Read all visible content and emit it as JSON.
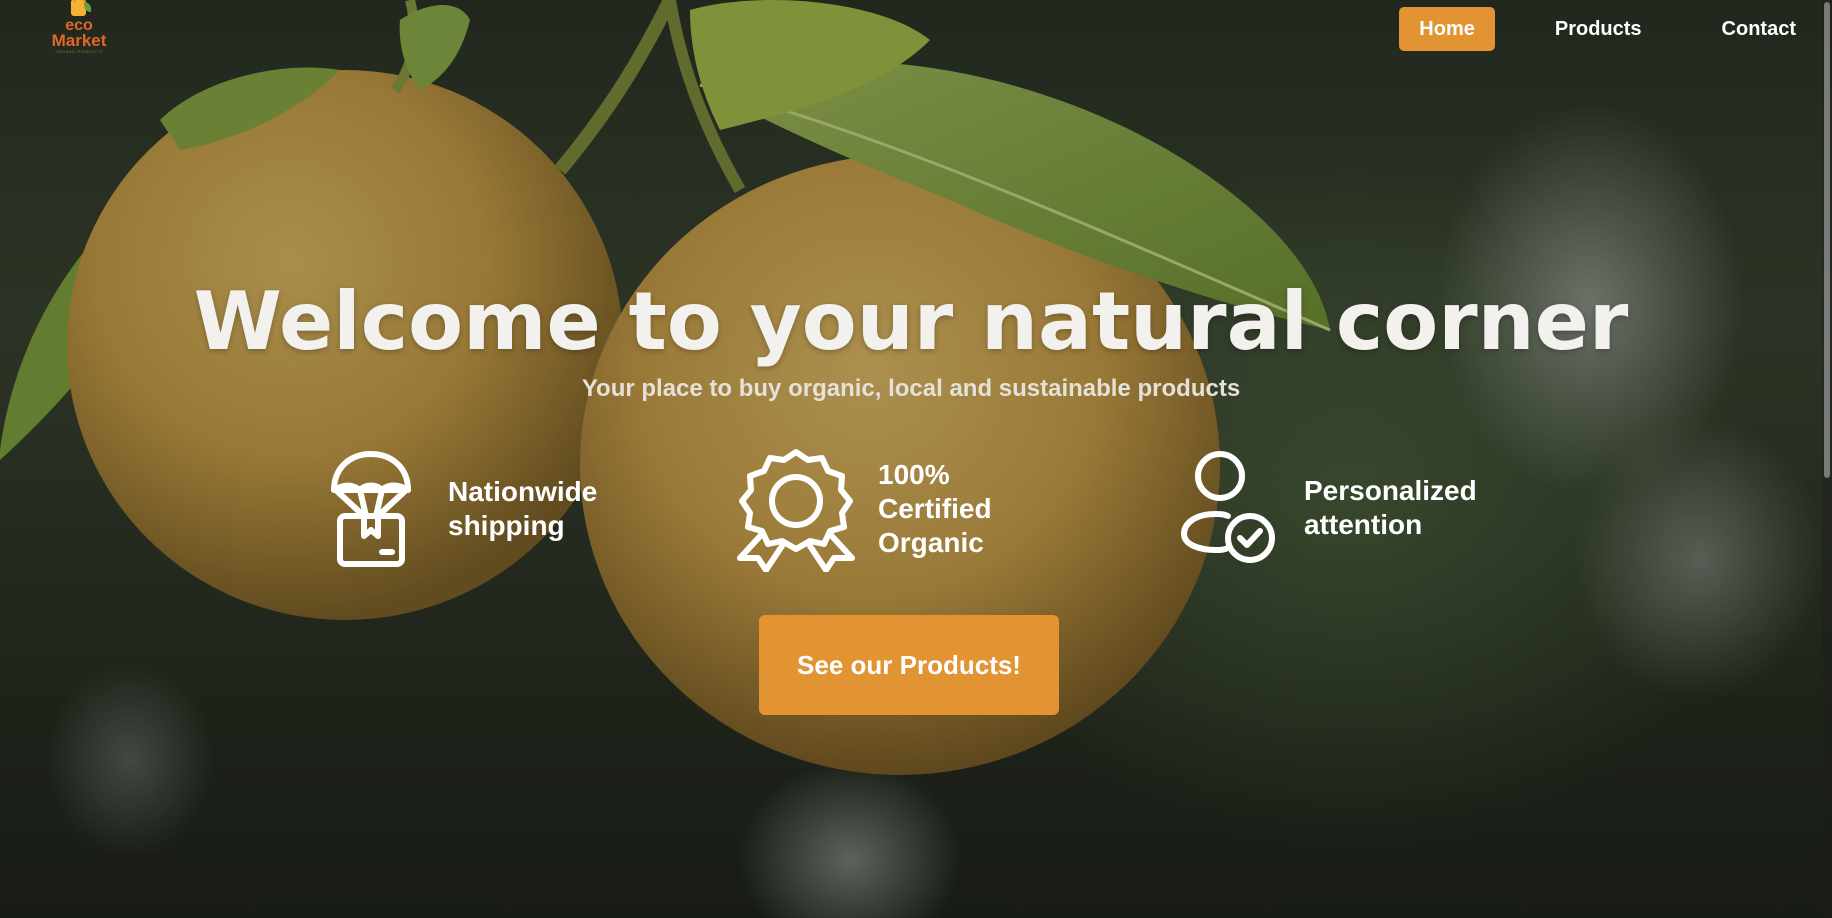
{
  "brand": {
    "logo_eco": "eco",
    "logo_market": "Market",
    "logo_tagline": "ORGANIC PRODUCTS"
  },
  "nav": {
    "items": [
      {
        "label": "Home",
        "active": true
      },
      {
        "label": "Products",
        "active": false
      },
      {
        "label": "Contact",
        "active": false
      }
    ]
  },
  "hero": {
    "title": "Welcome to your natural corner",
    "subtitle": "Your place to buy organic, local and sustainable products"
  },
  "features": [
    {
      "icon": "parachute-box-icon",
      "label": "Nationwide shipping"
    },
    {
      "icon": "award-badge-icon",
      "label": "100% Certified Organic"
    },
    {
      "icon": "user-check-icon",
      "label": "Personalized attention"
    }
  ],
  "cta": {
    "label": "See our Products!"
  },
  "colors": {
    "accent": "#e19431",
    "logo_text": "#e0672b",
    "text_light": "#ffffff"
  }
}
